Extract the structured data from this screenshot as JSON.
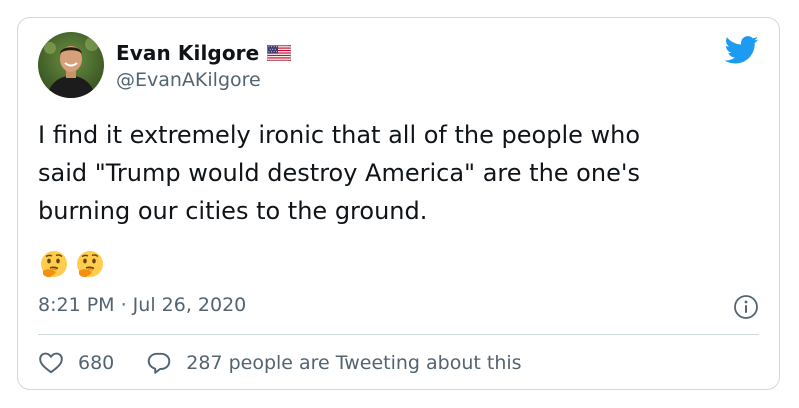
{
  "tweet": {
    "author": {
      "display_name": "Evan Kilgore",
      "handle": "@EvanAKilgore",
      "flag_icon": "us-flag-icon"
    },
    "text": "I find it extremely ironic that all of the people who\nsaid \"Trump would destroy America\" are the one's\nburning our cities to the ground.",
    "emojis": [
      "thinking-face-emoji",
      "thinking-face-emoji"
    ],
    "timestamp": "8:21 PM · Jul 26, 2020",
    "likes_count": "680",
    "conversation_label": "287 people are Tweeting about this"
  },
  "colors": {
    "text_primary": "#0f1419",
    "text_secondary": "#536471",
    "twitter_blue": "#1d9bf0",
    "border": "#cfd9de"
  },
  "icons": {
    "brand": "twitter-bird-icon",
    "info": "info-icon",
    "like": "heart-icon",
    "reply": "speech-bubble-icon"
  }
}
